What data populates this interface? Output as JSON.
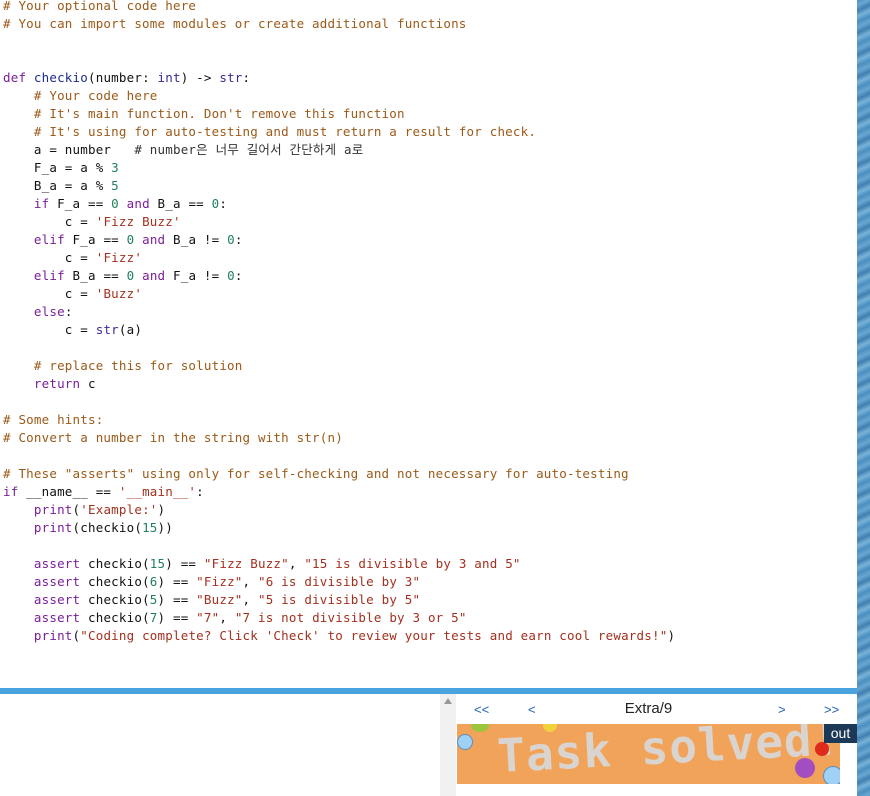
{
  "code_lines": [
    {
      "segs": [
        {
          "t": "# Your optional code here",
          "c": "cm"
        }
      ]
    },
    {
      "segs": [
        {
          "t": "# You can import some modules or create additional functions",
          "c": "cm"
        }
      ]
    },
    {
      "segs": []
    },
    {
      "segs": []
    },
    {
      "segs": [
        {
          "t": "def ",
          "c": "kw"
        },
        {
          "t": "checkio",
          "c": "fn"
        },
        {
          "t": "(number: "
        },
        {
          "t": "int",
          "c": "bi"
        },
        {
          "t": ") -> "
        },
        {
          "t": "str",
          "c": "bi"
        },
        {
          "t": ":"
        }
      ]
    },
    {
      "segs": [
        {
          "t": "    "
        },
        {
          "t": "# Your code here",
          "c": "cm"
        }
      ]
    },
    {
      "segs": [
        {
          "t": "    "
        },
        {
          "t": "# It's main function. Don't remove this function",
          "c": "cm"
        }
      ]
    },
    {
      "segs": [
        {
          "t": "    "
        },
        {
          "t": "# It's using for auto-testing and must return a result for check.",
          "c": "cm"
        }
      ]
    },
    {
      "segs": [
        {
          "t": "    a = number   "
        },
        {
          "t": "# number은 너무 길어서 간단하게 a로",
          "c": "ko"
        }
      ]
    },
    {
      "segs": [
        {
          "t": "    F_a = a % "
        },
        {
          "t": "3",
          "c": "nu"
        }
      ]
    },
    {
      "segs": [
        {
          "t": "    B_a = a % "
        },
        {
          "t": "5",
          "c": "nu"
        }
      ]
    },
    {
      "segs": [
        {
          "t": "    "
        },
        {
          "t": "if",
          "c": "kw"
        },
        {
          "t": " F_a == "
        },
        {
          "t": "0",
          "c": "nu"
        },
        {
          "t": " "
        },
        {
          "t": "and",
          "c": "kw"
        },
        {
          "t": " B_a == "
        },
        {
          "t": "0",
          "c": "nu"
        },
        {
          "t": ":"
        }
      ]
    },
    {
      "segs": [
        {
          "t": "        c = "
        },
        {
          "t": "'Fizz Buzz'",
          "c": "st"
        }
      ]
    },
    {
      "segs": [
        {
          "t": "    "
        },
        {
          "t": "elif",
          "c": "kw"
        },
        {
          "t": " F_a == "
        },
        {
          "t": "0",
          "c": "nu"
        },
        {
          "t": " "
        },
        {
          "t": "and",
          "c": "kw"
        },
        {
          "t": " B_a != "
        },
        {
          "t": "0",
          "c": "nu"
        },
        {
          "t": ":"
        }
      ]
    },
    {
      "segs": [
        {
          "t": "        c = "
        },
        {
          "t": "'Fizz'",
          "c": "st"
        }
      ]
    },
    {
      "segs": [
        {
          "t": "    "
        },
        {
          "t": "elif",
          "c": "kw"
        },
        {
          "t": " B_a == "
        },
        {
          "t": "0",
          "c": "nu"
        },
        {
          "t": " "
        },
        {
          "t": "and",
          "c": "kw"
        },
        {
          "t": " F_a != "
        },
        {
          "t": "0",
          "c": "nu"
        },
        {
          "t": ":"
        }
      ]
    },
    {
      "segs": [
        {
          "t": "        c = "
        },
        {
          "t": "'Buzz'",
          "c": "st"
        }
      ]
    },
    {
      "segs": [
        {
          "t": "    "
        },
        {
          "t": "else",
          "c": "kw"
        },
        {
          "t": ":"
        }
      ]
    },
    {
      "segs": [
        {
          "t": "        c = "
        },
        {
          "t": "str",
          "c": "bi"
        },
        {
          "t": "(a)"
        }
      ]
    },
    {
      "segs": []
    },
    {
      "segs": [
        {
          "t": "    "
        },
        {
          "t": "# replace this for solution",
          "c": "cm"
        }
      ]
    },
    {
      "segs": [
        {
          "t": "    "
        },
        {
          "t": "return",
          "c": "kw"
        },
        {
          "t": " c"
        }
      ]
    },
    {
      "segs": []
    },
    {
      "segs": [
        {
          "t": "# Some hints:",
          "c": "cm"
        }
      ]
    },
    {
      "segs": [
        {
          "t": "# Convert a number in the string with str(n)",
          "c": "cm"
        }
      ]
    },
    {
      "segs": []
    },
    {
      "segs": [
        {
          "t": "# These \"asserts\" using only for self-checking and not necessary for auto-testing",
          "c": "cm"
        }
      ]
    },
    {
      "segs": [
        {
          "t": "if",
          "c": "kw"
        },
        {
          "t": " __name__ == "
        },
        {
          "t": "'__main__'",
          "c": "st"
        },
        {
          "t": ":"
        }
      ]
    },
    {
      "segs": [
        {
          "t": "    "
        },
        {
          "t": "print",
          "c": "kw"
        },
        {
          "t": "("
        },
        {
          "t": "'Example:'",
          "c": "st"
        },
        {
          "t": ")"
        }
      ]
    },
    {
      "segs": [
        {
          "t": "    "
        },
        {
          "t": "print",
          "c": "kw"
        },
        {
          "t": "(checkio("
        },
        {
          "t": "15",
          "c": "nu"
        },
        {
          "t": "))"
        }
      ]
    },
    {
      "segs": []
    },
    {
      "segs": [
        {
          "t": "    "
        },
        {
          "t": "assert",
          "c": "kw"
        },
        {
          "t": " checkio("
        },
        {
          "t": "15",
          "c": "nu"
        },
        {
          "t": ") == "
        },
        {
          "t": "\"Fizz Buzz\"",
          "c": "st"
        },
        {
          "t": ", "
        },
        {
          "t": "\"15 is divisible by 3 and 5\"",
          "c": "st"
        }
      ]
    },
    {
      "segs": [
        {
          "t": "    "
        },
        {
          "t": "assert",
          "c": "kw"
        },
        {
          "t": " checkio("
        },
        {
          "t": "6",
          "c": "nu"
        },
        {
          "t": ") == "
        },
        {
          "t": "\"Fizz\"",
          "c": "st"
        },
        {
          "t": ", "
        },
        {
          "t": "\"6 is divisible by 3\"",
          "c": "st"
        }
      ]
    },
    {
      "segs": [
        {
          "t": "    "
        },
        {
          "t": "assert",
          "c": "kw"
        },
        {
          "t": " checkio("
        },
        {
          "t": "5",
          "c": "nu"
        },
        {
          "t": ") == "
        },
        {
          "t": "\"Buzz\"",
          "c": "st"
        },
        {
          "t": ", "
        },
        {
          "t": "\"5 is divisible by 5\"",
          "c": "st"
        }
      ]
    },
    {
      "segs": [
        {
          "t": "    "
        },
        {
          "t": "assert",
          "c": "kw"
        },
        {
          "t": " checkio("
        },
        {
          "t": "7",
          "c": "nu"
        },
        {
          "t": ") == "
        },
        {
          "t": "\"7\"",
          "c": "st"
        },
        {
          "t": ", "
        },
        {
          "t": "\"7 is not divisible by 3 or 5\"",
          "c": "st"
        }
      ]
    },
    {
      "segs": [
        {
          "t": "    "
        },
        {
          "t": "print",
          "c": "kw"
        },
        {
          "t": "("
        },
        {
          "t": "\"Coding complete? Click 'Check' to review your tests and earn cool rewards!\"",
          "c": "st"
        },
        {
          "t": ")"
        }
      ]
    }
  ],
  "nav": {
    "first": "<<",
    "prev": "<",
    "title": "Extra/9",
    "next": ">",
    "last": ">>"
  },
  "banner": {
    "text": "Task solved!",
    "out_label": "out"
  },
  "colors": {
    "banner_bg": "#f2a35a",
    "divider": "#4aa3df",
    "nav_link": "#1a5fb4"
  }
}
